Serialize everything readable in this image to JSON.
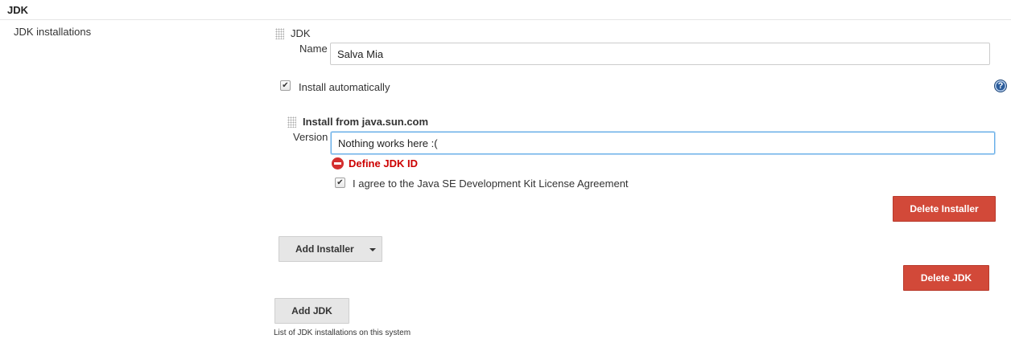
{
  "section": {
    "title": "JDK"
  },
  "jdk_installations": {
    "label": "JDK installations",
    "description": "List of JDK installations on this system",
    "add_jdk_label": "Add JDK"
  },
  "jdk": {
    "header": "JDK",
    "name_label": "Name",
    "name_value": "Salva Mia",
    "install_auto_label": "Install automatically",
    "install_auto_checked": true,
    "help_glyph": "?",
    "delete_label": "Delete JDK"
  },
  "installer": {
    "header": "Install from java.sun.com",
    "version_label": "Version",
    "version_value": "Nothing works here :(",
    "error_text": "Define JDK ID",
    "license_label": "I agree to the Java SE Development Kit License Agreement",
    "license_checked": true,
    "delete_label": "Delete Installer",
    "add_label": "Add Installer"
  },
  "colors": {
    "danger": "#d24939",
    "error_text": "#cc0000",
    "help_icon": "#2b5c9b",
    "focus": "#66afe9"
  },
  "icons": {
    "drag": "drag-handle-icon",
    "check": "checkmark-icon",
    "help": "help-icon",
    "error": "error-icon",
    "dropdown": "chevron-down-icon"
  }
}
